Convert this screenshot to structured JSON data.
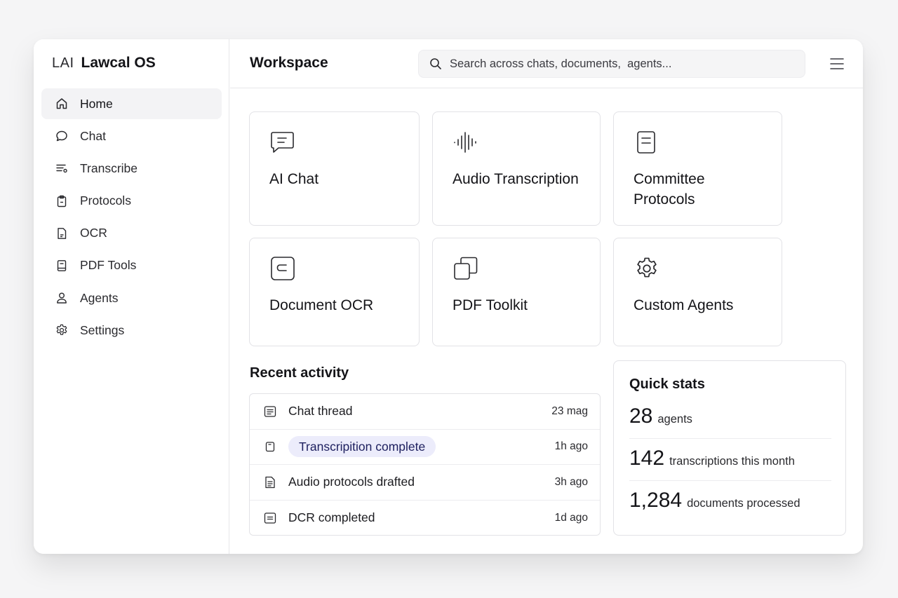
{
  "brand": {
    "mark": "LAI",
    "name": "Lawcal OS"
  },
  "sidebar": {
    "items": [
      {
        "label": "Home",
        "icon": "home-icon",
        "active": true
      },
      {
        "label": "Chat",
        "icon": "chat-bubble-icon"
      },
      {
        "label": "Transcribe",
        "icon": "transcribe-lines-icon"
      },
      {
        "label": "Protocols",
        "icon": "clipboard-icon"
      },
      {
        "label": "OCR",
        "icon": "document-icon"
      },
      {
        "label": "PDF Tools",
        "icon": "pdf-file-icon"
      },
      {
        "label": "Agents",
        "icon": "user-icon"
      },
      {
        "label": "Settings",
        "icon": "gear-icon"
      }
    ]
  },
  "header": {
    "title": "Workspace",
    "search_placeholder": "Search across chats, documents,  agents...",
    "menu_icon": "hamburger-menu-icon"
  },
  "cards": [
    {
      "title": "AI Chat",
      "icon": "chat-message-icon"
    },
    {
      "title": "Audio Transcription",
      "icon": "audio-waveform-icon"
    },
    {
      "title": "Committee Protocols",
      "icon": "document-lines-icon"
    },
    {
      "title": "Document OCR",
      "icon": "scan-frame-icon"
    },
    {
      "title": "PDF Toolkit",
      "icon": "copy-stack-icon"
    },
    {
      "title": "Custom Agents",
      "icon": "gear-icon"
    }
  ],
  "recent_activity": {
    "title": "Recent activity",
    "rows": [
      {
        "title": "Chat thread",
        "time": "23 mag",
        "icon": "text-file-icon",
        "highlighted": false
      },
      {
        "title": "Transcripition complete",
        "time": "1h ago",
        "icon": "small-file-icon",
        "highlighted": true
      },
      {
        "title": "Audio protocols drafted",
        "time": "3h ago",
        "icon": "document-icon",
        "highlighted": false
      },
      {
        "title": "DCR completed",
        "time": "1d ago",
        "icon": "text-file-icon",
        "highlighted": false
      }
    ]
  },
  "quick_stats": {
    "title": "Quick stats",
    "items": [
      {
        "value": "28",
        "label": "agents"
      },
      {
        "value": "142",
        "label": "transcriptions this month"
      },
      {
        "value": "1,284",
        "label": "documents processed"
      }
    ]
  },
  "colors": {
    "highlight_pill_bg": "#ececfb",
    "highlight_pill_text": "#1f2160",
    "active_nav_bg": "#f3f3f5"
  }
}
